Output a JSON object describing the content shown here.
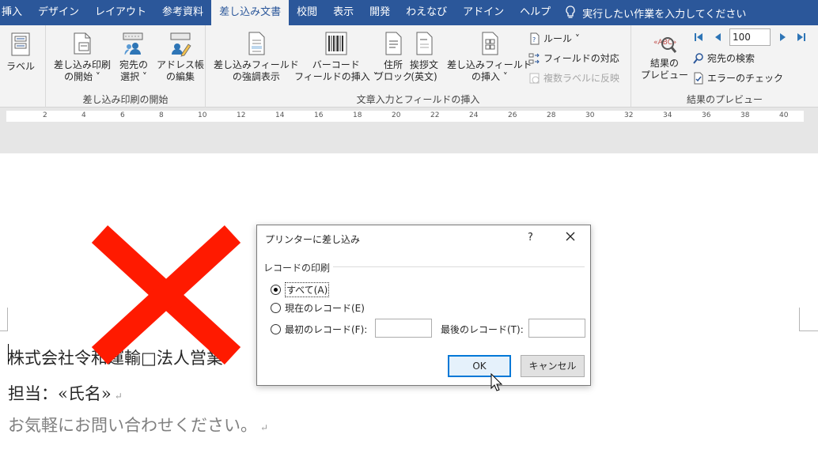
{
  "tabs": [
    "挿入",
    "デザイン",
    "レイアウト",
    "参考資料",
    "差し込み文書",
    "校閲",
    "表示",
    "開発",
    "わえなび",
    "アドイン",
    "ヘルプ"
  ],
  "active_tab": "差し込み文書",
  "tell_me": "実行したい作業を入力してください",
  "ribbon": {
    "labels_btn": "ラベル",
    "group_start": {
      "label": "差し込み印刷の開始",
      "start_merge": [
        "差し込み印刷",
        "の開始 ˅"
      ],
      "select_recipients": [
        "宛先の",
        "選択 ˅"
      ],
      "edit_list": [
        "アドレス帳",
        "の編集"
      ]
    },
    "group_write": {
      "label": "文章入力とフィールドの挿入",
      "highlight": [
        "差し込みフィールド",
        "の強調表示"
      ],
      "barcode": [
        "バーコード",
        "フィールドの挿入 ˅"
      ],
      "address": [
        "住所",
        "ブロック"
      ],
      "greeting": [
        "挨拶文",
        "(英文)"
      ],
      "insert_field": [
        "差し込みフィールド",
        "の挿入 ˅"
      ],
      "rules": "ルール ˅",
      "match_fields": "フィールドの対応",
      "update_labels": "複数ラベルに反映"
    },
    "group_preview": {
      "label": "結果のプレビュー",
      "preview": [
        "結果の",
        "プレビュー"
      ],
      "record_number": "100",
      "find_recipient": "宛先の検索",
      "check_errors": "エラーのチェック"
    }
  },
  "ruler_numbers": [
    "2",
    "4",
    "6",
    "8",
    "10",
    "12",
    "14",
    "16",
    "18",
    "20",
    "22",
    "24",
    "26",
    "28",
    "30",
    "32",
    "34",
    "36",
    "38",
    "40"
  ],
  "document": {
    "line1": "株式会社令和運輸□法人営業",
    "line2": "担当：«氏名»",
    "line3": "お気軽にお問い合わせください。",
    "para_mark": "↵"
  },
  "dialog": {
    "title": "プリンターに差し込み",
    "help": "?",
    "group_label": "レコードの印刷",
    "opt_all": "すべて(A)",
    "opt_current": "現在のレコード(E)",
    "opt_first": "最初のレコード(F):",
    "last_label": "最後のレコード(T):",
    "first_value": "",
    "last_value": "",
    "ok": "OK",
    "cancel": "キャンセル"
  },
  "colors": {
    "tabbar": "#2b579a",
    "big_x": "#ff1a00"
  },
  "icons": [
    "labels-icon",
    "start-merge-icon",
    "recipients-icon",
    "edit-list-icon",
    "highlight-fields-icon",
    "barcode-icon",
    "address-block-icon",
    "greeting-icon",
    "insert-field-icon",
    "rules-icon",
    "match-fields-icon",
    "update-labels-icon",
    "preview-icon",
    "first-record-icon",
    "prev-record-icon",
    "next-record-icon",
    "last-record-icon",
    "find-recipient-icon",
    "check-errors-icon",
    "lightbulb-icon",
    "close-icon",
    "mouse-cursor-icon",
    "red-x-mark"
  ]
}
